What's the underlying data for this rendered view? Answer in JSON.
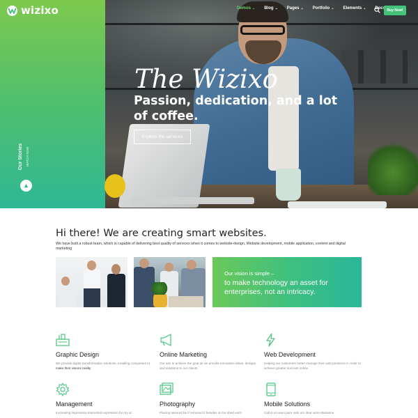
{
  "brand": {
    "name": "wizixo",
    "accent": "#46c37b",
    "gradient": [
      "#7dc94d",
      "#2fb894"
    ]
  },
  "nav": {
    "items": [
      {
        "label": "Demos",
        "active": true
      },
      {
        "label": "Blog",
        "active": false
      },
      {
        "label": "Pages",
        "active": false
      },
      {
        "label": "Portfolio",
        "active": false
      },
      {
        "label": "Elements",
        "active": false
      },
      {
        "label": "Docs",
        "active": false
      }
    ],
    "search_icon": "search-icon",
    "buy_label": "Buy Now!"
  },
  "hero": {
    "script_title": "The Wizixo",
    "headline": "Passion, dedication, and a lot of coffee.",
    "cta_label": "Explore the services"
  },
  "stories": {
    "title": "Our Stories",
    "subtitle": "WATCH NOW",
    "icon": "play-icon"
  },
  "intro": {
    "title": "Hi there! We are creating smart websites.",
    "text": "We have built a robust team, which is capable of delivering best quality of services when it comes to website-design, Website development, mobile application, content and digital marketing"
  },
  "vision": {
    "lead": "Our vision is simple –",
    "statement": "to make technology an asset for enterprises, not an intricacy."
  },
  "features": [
    {
      "icon": "design-tools-icon",
      "title": "Graphic Design",
      "text": "We provide digital transformation solutions, enabling companies to",
      "highlight": "make their visions reality"
    },
    {
      "icon": "megaphone-icon",
      "title": "Online Marketing",
      "text": "Our aim to achieve the goal as we provide innovative ideas, designs and solutions to our clients.",
      "highlight": ""
    },
    {
      "icon": "lightning-icon",
      "title": "Web Development",
      "text": "Helping our customers better manage their web presence in order to achieve greater success online.",
      "highlight": ""
    },
    {
      "icon": "gear-icon",
      "title": "Management",
      "text": "Increasing impression interested expression for my at",
      "highlight": ""
    },
    {
      "icon": "photo-icon",
      "title": "Photography",
      "text": "Placing assured be if removed it besides on far shed each",
      "highlight": ""
    },
    {
      "icon": "mobile-icon",
      "title": "Mobile Solutions",
      "text": "Call in so want pure rank am dear were Marianne",
      "highlight": ""
    }
  ]
}
